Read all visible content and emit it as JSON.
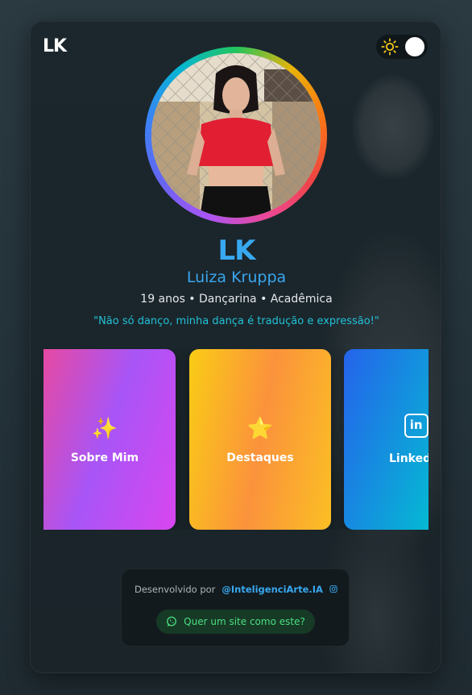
{
  "brand": {
    "logo_text": "LK"
  },
  "theme_toggle": {
    "icon": "sun-icon",
    "state": "on"
  },
  "profile": {
    "initials": "LK",
    "name": "Luiza Kruppa",
    "subtitle": "19 anos • Dançarina • Acadêmica",
    "quote": "\"Não só danço, minha dança é tradução e expressão!\""
  },
  "cards": [
    {
      "icon": "sparkles-icon",
      "glyph": "✨",
      "label": "Sobre Mim"
    },
    {
      "icon": "star-icon",
      "glyph": "⭐",
      "label": "Destaques"
    },
    {
      "icon": "linkedin-icon",
      "glyph": "in",
      "label": "LinkedIn"
    }
  ],
  "footer": {
    "developed_by": "Desenvolvido por",
    "developer_handle": "@InteligenciArte.IA",
    "developer_icon": "instagram-icon",
    "cta_icon": "whatsapp-icon",
    "cta_label": "Quer um site como este?"
  },
  "colors": {
    "accent": "#38a8f0",
    "quote": "#22c1d8",
    "cta_text": "#4ade80"
  }
}
